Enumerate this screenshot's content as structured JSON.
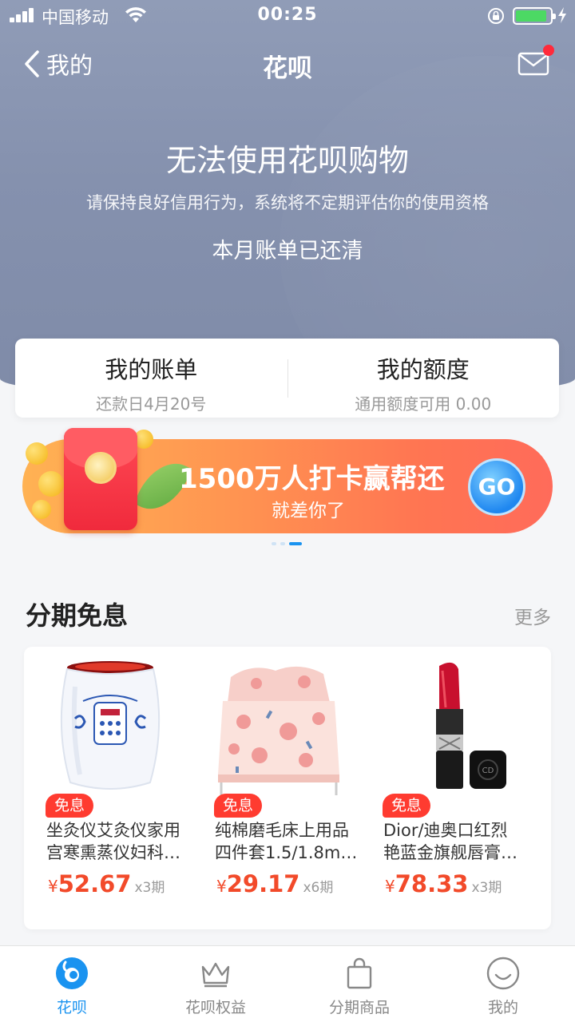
{
  "status_bar": {
    "carrier": "中国移动",
    "time": "00:25"
  },
  "nav": {
    "back_label": "我的",
    "title": "花呗",
    "mail_badge": true
  },
  "hero": {
    "headline": "无法使用花呗购物",
    "subline": "请保持良好信用行为，系统将不定期评估你的使用资格",
    "bill_status": "本月账单已还清"
  },
  "card": {
    "bill_title": "我的账单",
    "bill_sub": "还款日4月20号",
    "quota_title": "我的额度",
    "quota_sub": "通用额度可用 0.00"
  },
  "banner": {
    "title": "1500万人打卡赢帮还",
    "subtitle": "就差你了",
    "go_label": "GO",
    "page_count": 3,
    "active_page": 3
  },
  "section": {
    "title": "分期免息",
    "more_label": "更多"
  },
  "products": [
    {
      "tag": "免息",
      "name_line1": "坐灸仪艾灸仪家用",
      "name_line2": "宫寒熏蒸仪妇科…",
      "currency": "¥",
      "price": "52.67",
      "installments": "x3期"
    },
    {
      "tag": "免息",
      "name_line1": "纯棉磨毛床上用品",
      "name_line2": "四件套1.5/1.8m…",
      "currency": "¥",
      "price": "29.17",
      "installments": "x6期"
    },
    {
      "tag": "免息",
      "name_line1": "Dior/迪奥口红烈",
      "name_line2": "艳蓝金旗舰唇膏…",
      "currency": "¥",
      "price": "78.33",
      "installments": "x3期"
    }
  ],
  "tabbar": [
    {
      "label": "花呗",
      "icon": "huabei-icon",
      "active": true
    },
    {
      "label": "花呗权益",
      "icon": "crown-icon",
      "active": false
    },
    {
      "label": "分期商品",
      "icon": "shopping-bag-icon",
      "active": false
    },
    {
      "label": "我的",
      "icon": "smiley-icon",
      "active": false
    }
  ],
  "colors": {
    "accent": "#1a93f0",
    "price": "#f24a2a",
    "tag": "#ff3b30",
    "hero": "#8a96b2"
  }
}
